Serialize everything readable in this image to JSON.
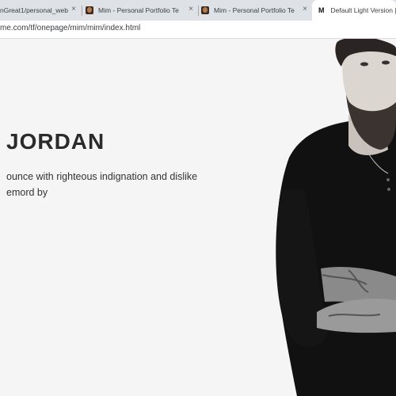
{
  "tabs": [
    {
      "label": "nGreat1/personal_web",
      "close": "×"
    },
    {
      "label": "Mim - Personal Portfolio Te",
      "close": "×"
    },
    {
      "label": "Mim - Personal Portfolio Te",
      "close": "×"
    },
    {
      "label": "Default Light Version |",
      "icon_letter": "M"
    }
  ],
  "address": {
    "url": "me.com/tf/onepage/mim/mim/index.html"
  },
  "hero": {
    "name": "JORDAN",
    "tagline": "ounce with righteous indignation and dislike emord by"
  },
  "colors": {
    "accent": "#2b2b2b",
    "background": "#f5f5f5",
    "tabstrip": "#dee1e6"
  },
  "icons": [
    "favicon-portrait-icon",
    "close-icon",
    "mim-logo-icon"
  ]
}
